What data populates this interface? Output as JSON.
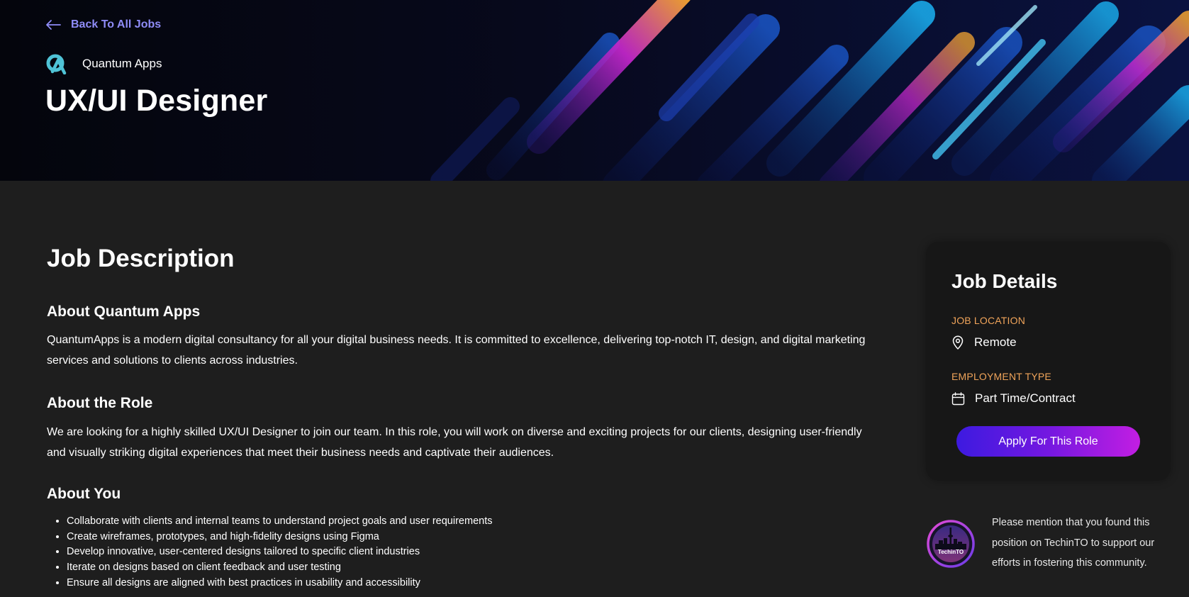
{
  "header": {
    "back_label": "Back To All Jobs",
    "company_name": "Quantum Apps",
    "job_title": "UX/UI Designer"
  },
  "main": {
    "section_title": "Job Description",
    "about_company": {
      "heading": "About Quantum Apps",
      "text": "QuantumApps is a modern digital consultancy for all your digital business needs. It is committed to excellence, delivering top-notch IT, design, and digital marketing services and solutions to clients across industries."
    },
    "about_role": {
      "heading": "About the Role",
      "text": "We are looking for a highly skilled UX/UI Designer to join our team. In this role, you will work on diverse and exciting projects for our clients, designing user-friendly and visually striking digital experiences that meet their business needs and captivate their audiences."
    },
    "about_you": {
      "heading": "About You",
      "items": [
        "Collaborate with clients and internal teams to understand project goals and user requirements",
        "Create wireframes, prototypes, and high-fidelity designs using Figma",
        "Develop innovative, user-centered designs tailored to specific client industries",
        "Iterate on designs based on client feedback and user testing",
        "Ensure all designs are aligned with best practices in usability and accessibility"
      ]
    }
  },
  "job_details": {
    "title": "Job Details",
    "location_label": "JOB LOCATION",
    "location_value": "Remote",
    "location_icon": "map-pin-icon",
    "employment_label": "EMPLOYMENT TYPE",
    "employment_value": "Part Time/Contract",
    "employment_icon": "calendar-icon",
    "apply_label": "Apply For This Role"
  },
  "mention": {
    "text": "Please mention that you found this position on TechinTO to support our efforts in fostering this community.",
    "logo_text": "TechinTO"
  },
  "colors": {
    "page_bg": "#1e1e1e",
    "card_bg": "#171717",
    "accent_link": "#8f8cf7",
    "label_orange": "#f0a45a",
    "button_gradient_start": "#3d1ae0",
    "button_gradient_end": "#c21ee2"
  }
}
